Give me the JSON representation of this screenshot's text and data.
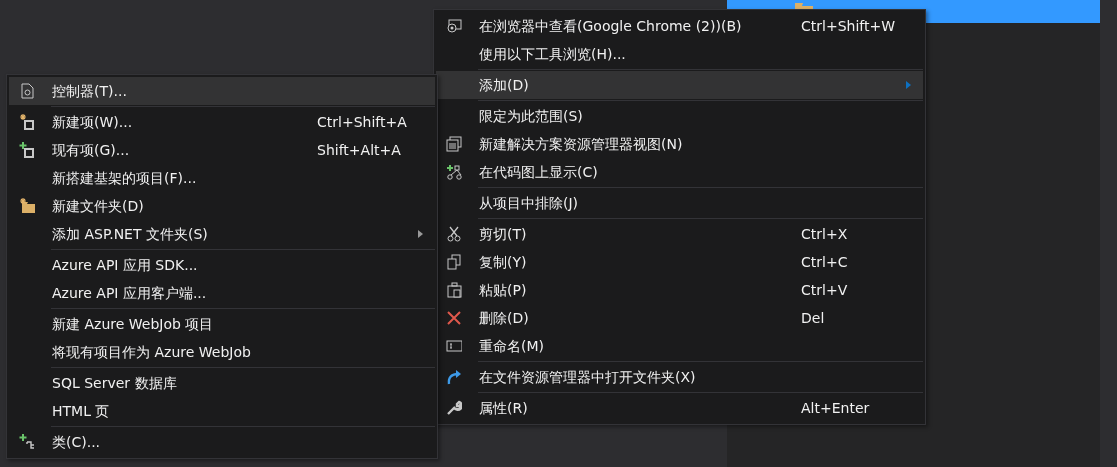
{
  "menus": [
    {
      "items": [
        {
          "kind": "item",
          "label": "在浏览器中查看(Google Chrome (2))(B)",
          "shortcut": "Ctrl+Shift+W",
          "selected": false,
          "submenu": false
        },
        {
          "kind": "item",
          "label": "使用以下工具浏览(H)...",
          "selected": false,
          "submenu": false
        },
        {
          "kind": "separator"
        },
        {
          "kind": "item",
          "label": "添加(D)",
          "selected": true,
          "submenu": true
        },
        {
          "kind": "separator"
        },
        {
          "kind": "item",
          "label": "限定为此范围(S)",
          "selected": false,
          "submenu": false
        },
        {
          "kind": "item",
          "label": "新建解决方案资源管理器视图(N)",
          "selected": false,
          "submenu": false
        },
        {
          "kind": "item",
          "label": "在代码图上显示(C)",
          "selected": false,
          "submenu": false
        },
        {
          "kind": "separator"
        },
        {
          "kind": "item",
          "label": "从项目中排除(J)",
          "selected": false,
          "submenu": false
        },
        {
          "kind": "separator"
        },
        {
          "kind": "item",
          "label": "剪切(T)",
          "shortcut": "Ctrl+X",
          "selected": false,
          "submenu": false
        },
        {
          "kind": "item",
          "label": "复制(Y)",
          "shortcut": "Ctrl+C",
          "selected": false,
          "submenu": false
        },
        {
          "kind": "item",
          "label": "粘贴(P)",
          "shortcut": "Ctrl+V",
          "selected": false,
          "submenu": false
        },
        {
          "kind": "item",
          "label": "删除(D)",
          "shortcut": "Del",
          "selected": false,
          "submenu": false
        },
        {
          "kind": "item",
          "label": "重命名(M)",
          "selected": false,
          "submenu": false
        },
        {
          "kind": "separator"
        },
        {
          "kind": "item",
          "label": "在文件资源管理器中打开文件夹(X)",
          "selected": false,
          "submenu": false
        },
        {
          "kind": "separator"
        },
        {
          "kind": "item",
          "label": "属性(R)",
          "shortcut": "Alt+Enter",
          "selected": false,
          "submenu": false
        }
      ]
    },
    {
      "items": [
        {
          "kind": "item",
          "label": "控制器(T)...",
          "selected": true,
          "submenu": false
        },
        {
          "kind": "separator"
        },
        {
          "kind": "item",
          "label": "新建项(W)...",
          "shortcut": "Ctrl+Shift+A",
          "selected": false,
          "submenu": false
        },
        {
          "kind": "item",
          "label": "现有项(G)...",
          "shortcut": "Shift+Alt+A",
          "selected": false,
          "submenu": false
        },
        {
          "kind": "item",
          "label": "新搭建基架的项目(F)...",
          "selected": false,
          "submenu": false
        },
        {
          "kind": "item",
          "label": "新建文件夹(D)",
          "selected": false,
          "submenu": false
        },
        {
          "kind": "item",
          "label": "添加 ASP.NET 文件夹(S)",
          "selected": false,
          "submenu": true
        },
        {
          "kind": "separator"
        },
        {
          "kind": "item",
          "label": "Azure API 应用 SDK...",
          "selected": false,
          "submenu": false
        },
        {
          "kind": "item",
          "label": "Azure API 应用客户端...",
          "selected": false,
          "submenu": false
        },
        {
          "kind": "separator"
        },
        {
          "kind": "item",
          "label": "新建 Azure WebJob 项目",
          "selected": false,
          "submenu": false
        },
        {
          "kind": "item",
          "label": "将现有项目作为 Azure WebJob",
          "selected": false,
          "submenu": false
        },
        {
          "kind": "separator"
        },
        {
          "kind": "item",
          "label": "SQL Server 数据库",
          "selected": false,
          "submenu": false
        },
        {
          "kind": "item",
          "label": "HTML 页",
          "selected": false,
          "submenu": false
        },
        {
          "kind": "separator"
        },
        {
          "kind": "item",
          "label": "类(C)...",
          "selected": false,
          "submenu": false
        }
      ]
    }
  ]
}
